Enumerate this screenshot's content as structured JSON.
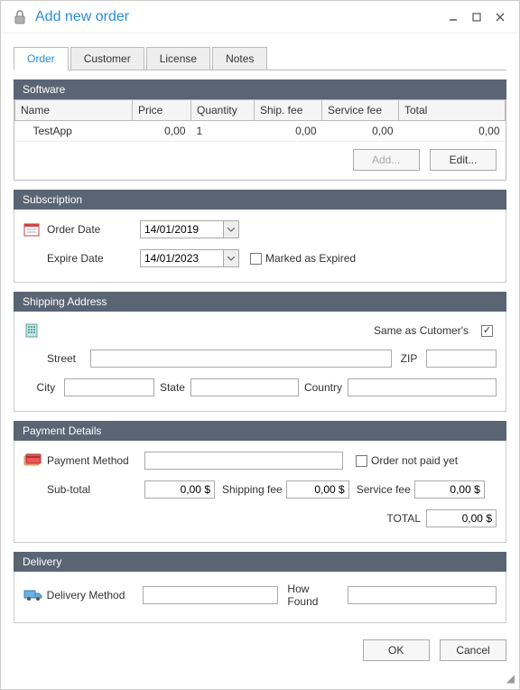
{
  "window": {
    "title": "Add new order"
  },
  "tabs": [
    "Order",
    "Customer",
    "License",
    "Notes"
  ],
  "sections": {
    "software": {
      "title": "Software",
      "columns": [
        "Name",
        "Price",
        "Quantity",
        "Ship. fee",
        "Service fee",
        "Total"
      ],
      "rows": [
        {
          "name": "TestApp",
          "price": "0,00",
          "quantity": "1",
          "ship_fee": "0,00",
          "service_fee": "0,00",
          "total": "0,00"
        }
      ],
      "add_btn": "Add...",
      "edit_btn": "Edit..."
    },
    "subscription": {
      "title": "Subscription",
      "order_date_label": "Order Date",
      "order_date": "14/01/2019",
      "expire_date_label": "Expire Date",
      "expire_date": "14/01/2023",
      "marked_expired_label": "Marked as Expired",
      "marked_expired_checked": false
    },
    "shipping": {
      "title": "Shipping Address",
      "same_as_label": "Same as Cutomer's",
      "same_as_checked": true,
      "street_label": "Street",
      "street": "",
      "zip_label": "ZIP",
      "zip": "",
      "city_label": "City",
      "city": "",
      "state_label": "State",
      "state": "",
      "country_label": "Country",
      "country": ""
    },
    "payment": {
      "title": "Payment Details",
      "method_label": "Payment Method",
      "method": "",
      "not_paid_label": "Order not paid yet",
      "not_paid_checked": false,
      "subtotal_label": "Sub-total",
      "subtotal": "0,00 $",
      "shipping_label": "Shipping fee",
      "shipping": "0,00 $",
      "service_label": "Service fee",
      "service": "0,00 $",
      "total_label": "TOTAL",
      "total": "0,00 $"
    },
    "delivery": {
      "title": "Delivery",
      "method_label": "Delivery Method",
      "method": "",
      "how_found_label": "How Found",
      "how_found": ""
    }
  },
  "buttons": {
    "ok": "OK",
    "cancel": "Cancel"
  }
}
